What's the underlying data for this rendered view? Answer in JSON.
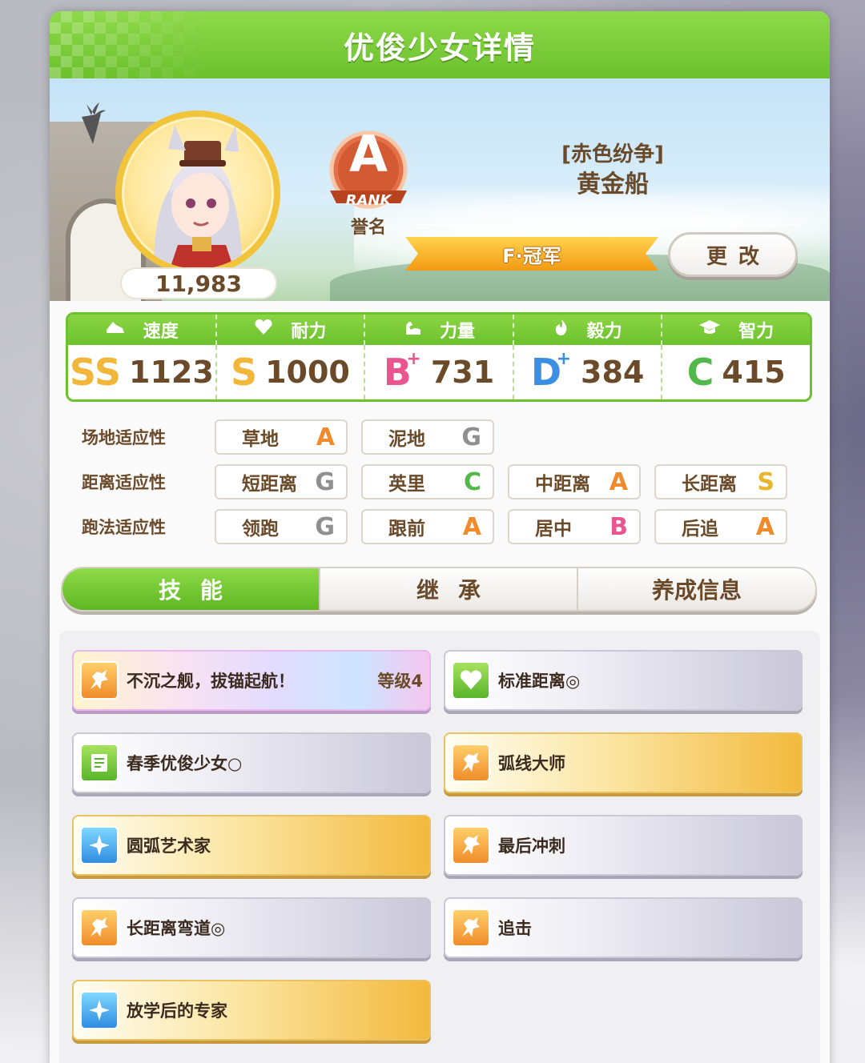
{
  "header": {
    "title": "优俊少女详情"
  },
  "character": {
    "fans": "11,983",
    "rank_letter": "A",
    "rank_word": "RANK",
    "rank_caption": "誉名",
    "epithet": "[赤色纷争]",
    "name": "黄金船",
    "title_ribbon": "F·冠军",
    "change_label": "更改"
  },
  "stats": [
    {
      "label": "速度",
      "icon": "shoe-icon",
      "grade": "SS",
      "plus": "",
      "value": "1123",
      "grade_color": "#f2b63a"
    },
    {
      "label": "耐力",
      "icon": "heart-icon",
      "grade": "S",
      "plus": "",
      "value": "1000",
      "grade_color": "#f2b63a"
    },
    {
      "label": "力量",
      "icon": "muscle-icon",
      "grade": "B",
      "plus": "+",
      "value": "731",
      "grade_color": "#e9568f"
    },
    {
      "label": "毅力",
      "icon": "flame-icon",
      "grade": "D",
      "plus": "+",
      "value": "384",
      "grade_color": "#3b8fe3"
    },
    {
      "label": "智力",
      "icon": "graduation-cap-icon",
      "grade": "C",
      "plus": "",
      "value": "415",
      "grade_color": "#53b84a"
    }
  ],
  "aptitudes": {
    "track": {
      "label": "场地适应性",
      "items": [
        {
          "name": "草地",
          "grade": "A",
          "color": "#f08a2a"
        },
        {
          "name": "泥地",
          "grade": "G",
          "color": "#8f8f8f"
        }
      ]
    },
    "distance": {
      "label": "距离适应性",
      "items": [
        {
          "name": "短距离",
          "grade": "G",
          "color": "#8f8f8f"
        },
        {
          "name": "英里",
          "grade": "C",
          "color": "#53b84a"
        },
        {
          "name": "中距离",
          "grade": "A",
          "color": "#f08a2a"
        },
        {
          "name": "长距离",
          "grade": "S",
          "color": "#e9b52c"
        }
      ]
    },
    "strategy": {
      "label": "跑法适应性",
      "items": [
        {
          "name": "领跑",
          "grade": "G",
          "color": "#8f8f8f"
        },
        {
          "name": "跟前",
          "grade": "A",
          "color": "#f08a2a"
        },
        {
          "name": "居中",
          "grade": "B",
          "color": "#e9568f"
        },
        {
          "name": "后追",
          "grade": "A",
          "color": "#f08a2a"
        }
      ]
    }
  },
  "tabs": [
    "技能",
    "继承",
    "养成信息"
  ],
  "skills": [
    {
      "name": "不沉之舰，拔锚起航！",
      "level": "等级4",
      "style": "rainbow",
      "icon": "running-horse-icon"
    },
    {
      "name": "标准距离◎",
      "level": "",
      "style": "silver",
      "icon": "heart-icon"
    },
    {
      "name": "春季优俊少女○",
      "level": "",
      "style": "silver",
      "icon": "document-icon"
    },
    {
      "name": "弧线大师",
      "level": "",
      "style": "gold",
      "icon": "running-horse-icon"
    },
    {
      "name": "圆弧艺术家",
      "level": "",
      "style": "gold",
      "icon": "sparkle-icon"
    },
    {
      "name": "最后冲刺",
      "level": "",
      "style": "silver",
      "icon": "running-horse-icon"
    },
    {
      "name": "长距离弯道◎",
      "level": "",
      "style": "silver",
      "icon": "running-horse-icon"
    },
    {
      "name": "追击",
      "level": "",
      "style": "silver",
      "icon": "running-horse-icon"
    },
    {
      "name": "放学后的专家",
      "level": "",
      "style": "gold",
      "icon": "sparkle-icon"
    }
  ]
}
